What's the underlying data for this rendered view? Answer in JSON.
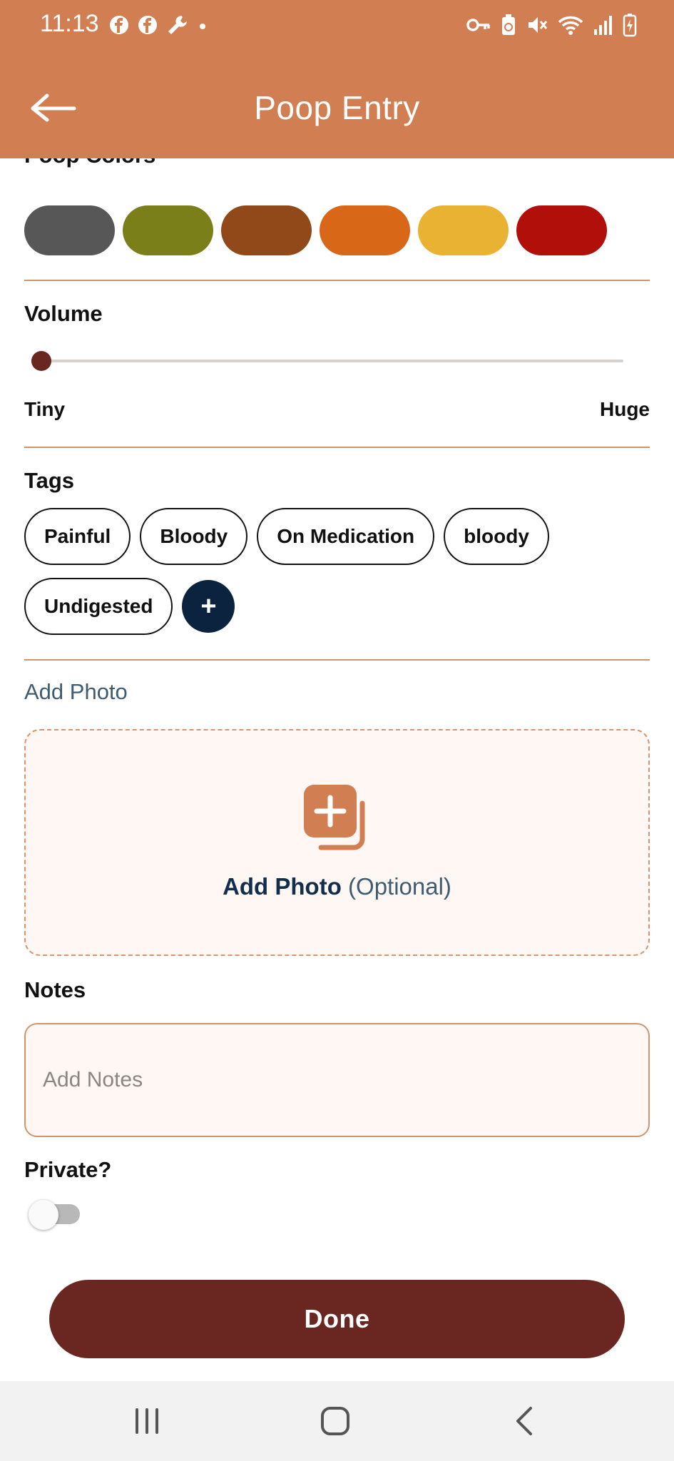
{
  "status_bar": {
    "time": "11:13",
    "left_icons": [
      "facebook-icon",
      "facebook-icon",
      "wrench-icon",
      "dot-icon"
    ],
    "right_icons": [
      "key-icon",
      "battery-saver-icon",
      "mute-icon",
      "wifi-icon",
      "signal-icon",
      "battery-icon"
    ]
  },
  "header": {
    "title": "Poop Entry",
    "back_icon": "arrow-left-icon",
    "color": "#D17F52"
  },
  "colors_section": {
    "label": "Poop Colors",
    "swatches": [
      "#575757",
      "#7A7F1A",
      "#924919",
      "#D96718",
      "#E9B232",
      "#B00F0A"
    ]
  },
  "volume": {
    "label": "Volume",
    "min_label": "Tiny",
    "max_label": "Huge",
    "value": 0
  },
  "tags": {
    "label": "Tags",
    "items": [
      "Painful",
      "Bloody",
      "On Medication",
      "bloody",
      "Undigested"
    ],
    "add_label": "+"
  },
  "photo": {
    "title": "Add Photo",
    "caption_bold": "Add Photo",
    "caption_optional": "(Optional)",
    "icon": "add-photo-icon"
  },
  "notes": {
    "label": "Notes",
    "placeholder": "Add Notes"
  },
  "private": {
    "label": "Private?",
    "checked": false
  },
  "done_label": "Done",
  "nav": {
    "icons": [
      "recent-apps-icon",
      "home-icon",
      "back-icon"
    ]
  }
}
